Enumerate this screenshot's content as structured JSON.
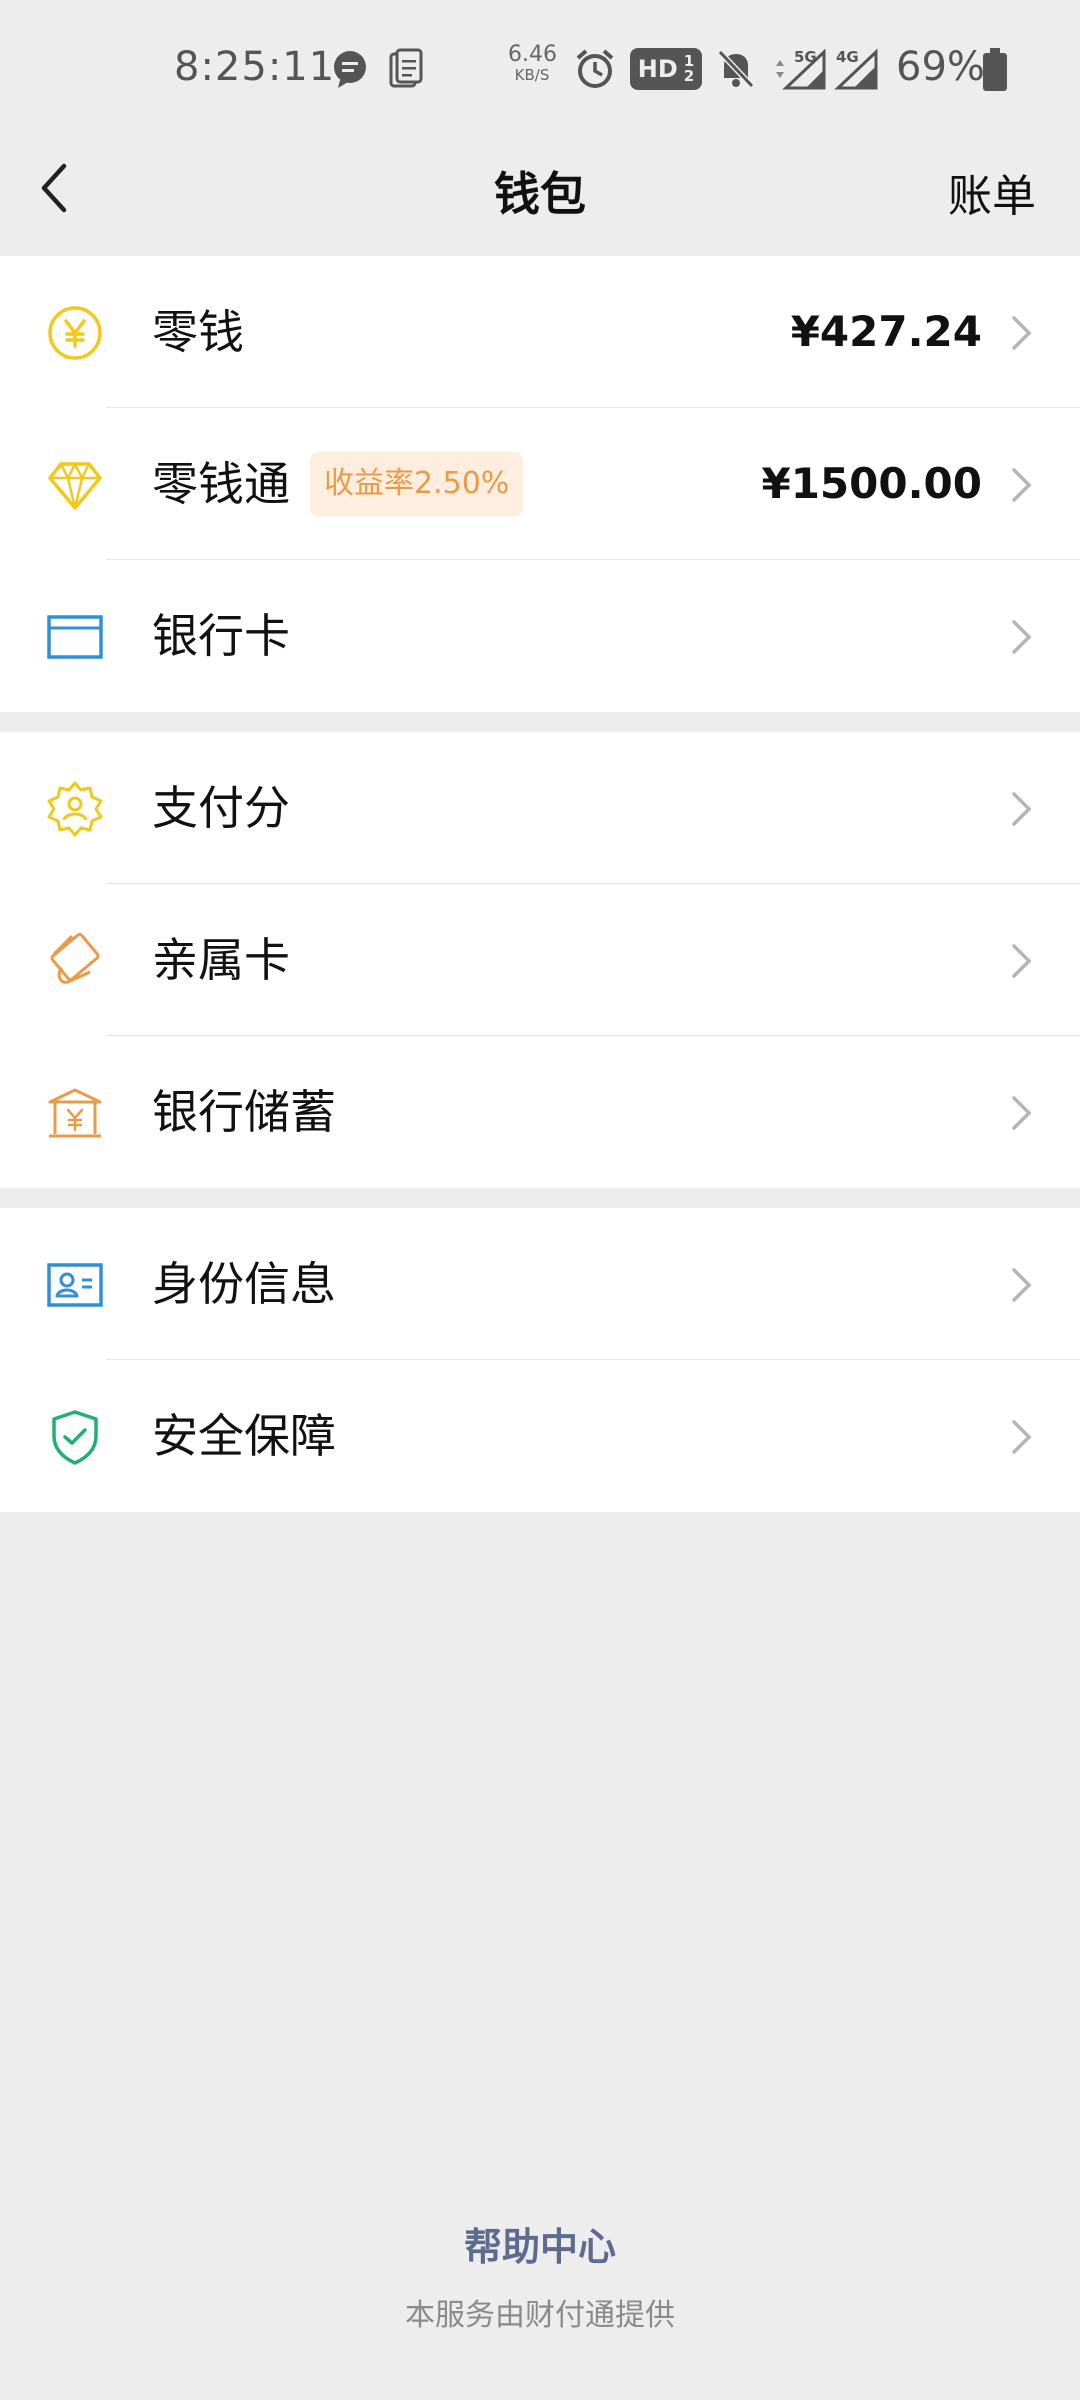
{
  "status_bar": {
    "time": "8:25:11",
    "net_speed_value": "6.46",
    "net_speed_unit": "KB/S",
    "hd_label": "HD",
    "sig1_label": "5G",
    "sig2_label": "4G",
    "battery": "69%",
    "icons": [
      "message-icon",
      "clipboard-icon",
      "alarm-icon",
      "hd-icon",
      "mute-icon",
      "signal-5g-icon",
      "signal-4g-icon",
      "battery-icon"
    ]
  },
  "nav": {
    "title": "钱包",
    "right_label": "账单"
  },
  "groups": [
    {
      "items": [
        {
          "label": "零钱",
          "value": "¥427.24",
          "icon": "yuan-coin-icon"
        },
        {
          "label": "零钱通",
          "badge": "收益率2.50%",
          "value": "¥1500.00",
          "icon": "diamond-icon"
        },
        {
          "label": "银行卡",
          "icon": "bank-card-icon"
        }
      ]
    },
    {
      "items": [
        {
          "label": "支付分",
          "icon": "payment-score-icon"
        },
        {
          "label": "亲属卡",
          "icon": "family-card-icon"
        },
        {
          "label": "银行储蓄",
          "icon": "bank-savings-icon"
        }
      ]
    },
    {
      "items": [
        {
          "label": "身份信息",
          "icon": "id-card-icon"
        },
        {
          "label": "安全保障",
          "icon": "shield-check-icon"
        }
      ]
    }
  ],
  "footer": {
    "help": "帮助中心",
    "provider": "本服务由财付通提供"
  },
  "colors": {
    "background": "#ededed",
    "yellow": "#f2c91b",
    "orange": "#eb9a48",
    "blue": "#2f8fd9",
    "green": "#1fb170",
    "link": "#5c6b8e"
  }
}
